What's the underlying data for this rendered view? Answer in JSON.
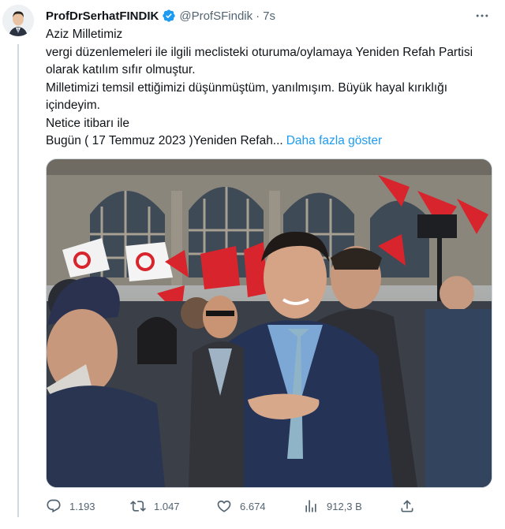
{
  "tweet": {
    "display_name": "ProfDrSerhatFINDIK",
    "handle": "@ProfSFindik",
    "separator": "·",
    "time": "7s",
    "body_lines": [
      "Aziz Milletimiz",
      "vergi düzenlemeleri ile ilgili meclisteki  oturuma/oylamaya Yeniden Refah Partisi olarak katılım sıfır olmuştur.",
      "Milletimizi temsil ettiğimizi düşünmüştüm, yanılmışım. Büyük hayal kırıklığı içindeyim.",
      "Netice itibarı ile",
      "Bugün ( 17 Temmuz 2023 )Yeniden Refah..."
    ],
    "show_more": "Daha fazla göster",
    "stats": {
      "replies": "1.193",
      "retweets": "1.047",
      "likes": "6.674",
      "views": "912,3 B"
    },
    "icons": {
      "verified": "verified-badge-icon",
      "more": "more-options-icon",
      "reply": "reply-icon",
      "retweet": "retweet-icon",
      "like": "heart-icon",
      "views": "views-icon",
      "share": "share-icon"
    },
    "colors": {
      "accent": "#1d9bf0",
      "muted": "#536471",
      "text": "#0f1419",
      "flag_red": "#d8242c"
    }
  }
}
